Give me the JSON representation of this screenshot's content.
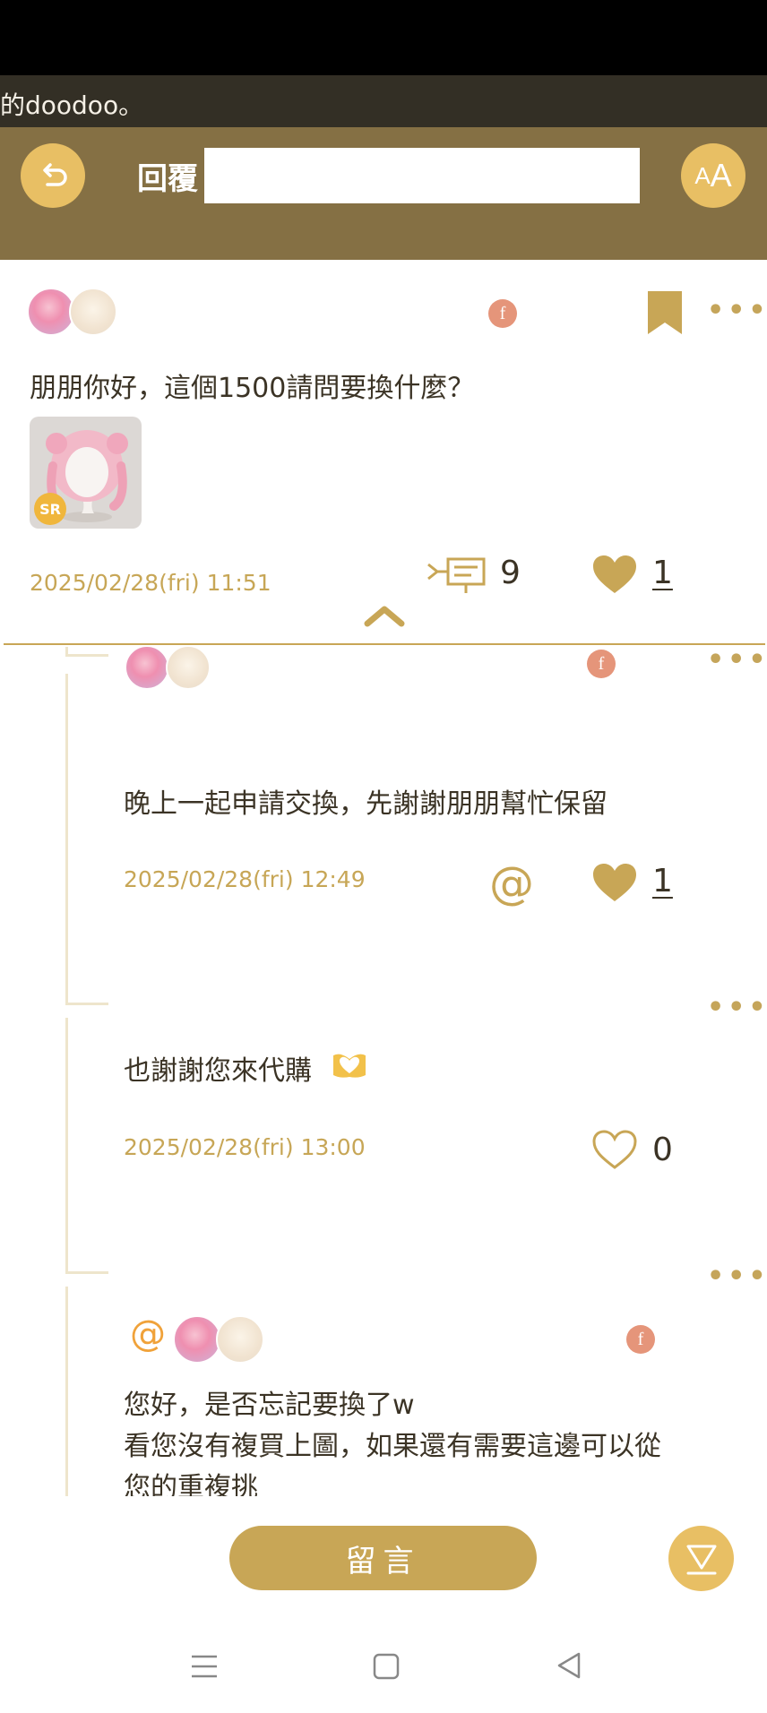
{
  "ticker": {
    "text": "的doodoo。"
  },
  "header": {
    "title": "回覆",
    "accent": "#857044"
  },
  "colors": {
    "gold": "#c8a656",
    "button_gold": "#e8bf64",
    "date": "#c7a656"
  },
  "main_post": {
    "text": "朋朋你好，這個1500請問要換什麼？",
    "thumbnail_badge": "SR",
    "date": "2025/02/28(fri) 11:51",
    "reply_count": "9",
    "like_count": "1"
  },
  "replies": [
    {
      "text": "晚上一起申請交換，先謝謝朋朋幫忙保留",
      "date": "2025/02/28(fri) 12:49",
      "like_count": "1"
    },
    {
      "text": "也謝謝您來代購",
      "date": "2025/02/28(fri) 13:00",
      "like_count": "0"
    },
    {
      "line1": "您好，是否忘記要換了w",
      "line2": "看您沒有複買上圖，如果還有需要這邊可以從",
      "line3": "您的重複挑"
    }
  ],
  "bottom": {
    "comment_label": "留言"
  }
}
